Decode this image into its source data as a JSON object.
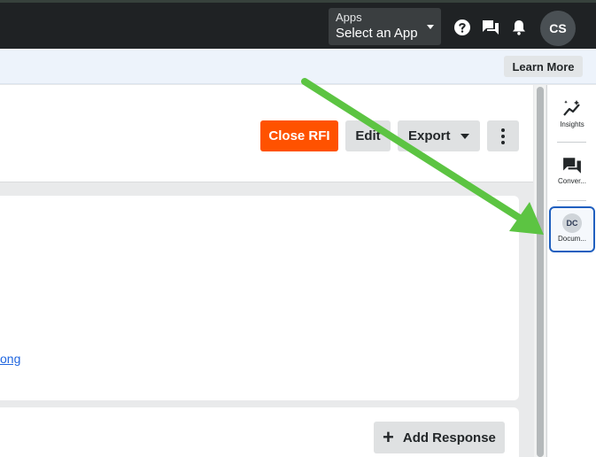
{
  "topbar": {
    "apps_label": "Apps",
    "apps_value": "Select an App",
    "avatar_initials": "CS",
    "icons": [
      "help-icon",
      "conversations-icon",
      "bell-icon"
    ]
  },
  "banner": {
    "learn_more": "Learn More"
  },
  "header": {
    "close_rfi": "Close RFI",
    "edit": "Edit",
    "export": "Export"
  },
  "body": {
    "link_text": "ong",
    "add_response": "Add Response"
  },
  "right_panel": {
    "items": [
      {
        "label": "Insights",
        "icon": "insights-icon"
      },
      {
        "label": "Conver...",
        "icon": "conversations-icon"
      },
      {
        "label": "Docum...",
        "icon": "documents-icon",
        "badge": "DC"
      }
    ]
  },
  "colors": {
    "primary_orange": "#ff5200",
    "annotation_green": "#5cc442",
    "active_border": "#1f5fbf"
  }
}
